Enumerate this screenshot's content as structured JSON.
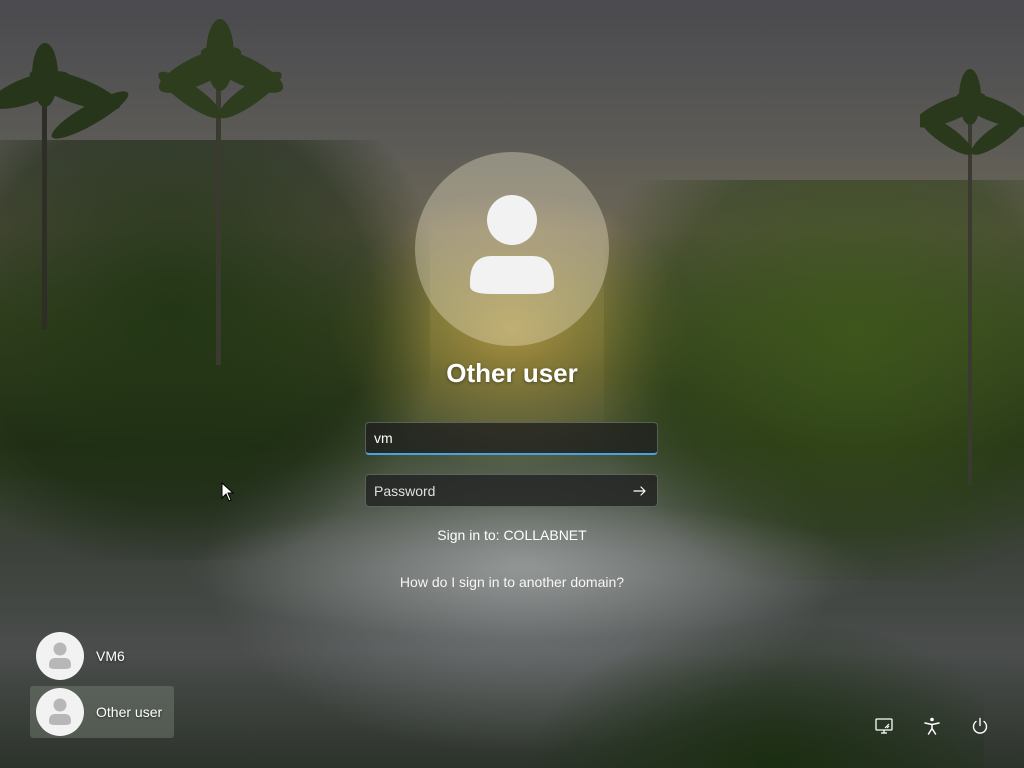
{
  "login": {
    "display_name": "Other user",
    "username_value": "vm",
    "password_placeholder": "Password",
    "sign_in_to": "Sign in to: COLLABNET",
    "other_domain_link": "How do I sign in to another domain?"
  },
  "users": [
    {
      "name": "VM6",
      "selected": false
    },
    {
      "name": "Other user",
      "selected": true
    }
  ],
  "system_buttons": {
    "network": "network-icon",
    "accessibility": "accessibility-icon",
    "power": "power-icon"
  },
  "colors": {
    "focus_underline": "#4aa3df",
    "avatar_fill": "#f2f2f2"
  }
}
